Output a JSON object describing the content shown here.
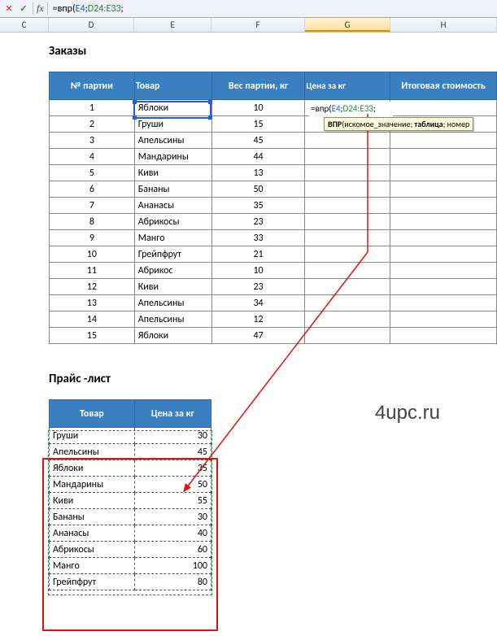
{
  "formula_bar": {
    "cancel": "✕",
    "enter": "✓",
    "fx": "fx",
    "formula_prefix": "=впр(",
    "arg1": "E4",
    "sep": ";",
    "arg2": "D24:E33",
    "suffix": ";"
  },
  "columns": {
    "C": "C",
    "D": "D",
    "E": "E",
    "F": "F",
    "G": "G",
    "H": "H"
  },
  "titles": {
    "orders": "Заказы",
    "price": "Прайс -лист"
  },
  "orders": {
    "headers": {
      "num": "№ партии",
      "product": "Товар",
      "weight": "Вес партии, кг",
      "price": "Цена за кг",
      "total": "Итоговая стоимость"
    },
    "rows": [
      {
        "n": "1",
        "p": "Яблоки",
        "w": "10"
      },
      {
        "n": "2",
        "p": "Груши",
        "w": "15"
      },
      {
        "n": "3",
        "p": "Апельсины",
        "w": "45"
      },
      {
        "n": "4",
        "p": "Мандарины",
        "w": "44"
      },
      {
        "n": "5",
        "p": "Киви",
        "w": "13"
      },
      {
        "n": "6",
        "p": "Бананы",
        "w": "50"
      },
      {
        "n": "7",
        "p": "Ананасы",
        "w": "35"
      },
      {
        "n": "8",
        "p": "Абрикосы",
        "w": "23"
      },
      {
        "n": "9",
        "p": "Манго",
        "w": "33"
      },
      {
        "n": "10",
        "p": "Грейпфрут",
        "w": "21"
      },
      {
        "n": "11",
        "p": "Абрикос",
        "w": "10"
      },
      {
        "n": "12",
        "p": "Киви",
        "w": "23"
      },
      {
        "n": "13",
        "p": "Апельсины",
        "w": "34"
      },
      {
        "n": "14",
        "p": "Апельсины",
        "w": "12"
      },
      {
        "n": "15",
        "p": "Яблоки",
        "w": "47"
      }
    ]
  },
  "active_cell_formula": {
    "prefix": "=впр(",
    "arg1": "E4",
    "sep": ";",
    "arg2": "D24:E33",
    "suffix": ";"
  },
  "tooltip": {
    "fn": "ВПР",
    "open": "(",
    "a1": "искомое_значение",
    "s1": "; ",
    "a2": "таблица",
    "s2": "; номер"
  },
  "price": {
    "headers": {
      "product": "Товар",
      "price": "Цена за кг"
    },
    "rows": [
      {
        "p": "Груши",
        "v": "30"
      },
      {
        "p": "Апельсины",
        "v": "45"
      },
      {
        "p": "Яблоки",
        "v": "35"
      },
      {
        "p": "Мандарины",
        "v": "50"
      },
      {
        "p": "Киви",
        "v": "55"
      },
      {
        "p": "Бананы",
        "v": "30"
      },
      {
        "p": "Ананасы",
        "v": "40"
      },
      {
        "p": "Абрикосы",
        "v": "60"
      },
      {
        "p": "Манго",
        "v": "100"
      },
      {
        "p": "Грейпфрут",
        "v": "80"
      }
    ]
  },
  "watermark": "4upc.ru",
  "chart_data": [
    {
      "type": "table",
      "title": "Заказы",
      "columns": [
        "№ партии",
        "Товар",
        "Вес партии, кг",
        "Цена за кг",
        "Итоговая стоимость"
      ],
      "rows": [
        [
          1,
          "Яблоки",
          10,
          null,
          null
        ],
        [
          2,
          "Груши",
          15,
          null,
          null
        ],
        [
          3,
          "Апельсины",
          45,
          null,
          null
        ],
        [
          4,
          "Мандарины",
          44,
          null,
          null
        ],
        [
          5,
          "Киви",
          13,
          null,
          null
        ],
        [
          6,
          "Бананы",
          50,
          null,
          null
        ],
        [
          7,
          "Ананасы",
          35,
          null,
          null
        ],
        [
          8,
          "Абрикосы",
          23,
          null,
          null
        ],
        [
          9,
          "Манго",
          33,
          null,
          null
        ],
        [
          10,
          "Грейпфрут",
          21,
          null,
          null
        ],
        [
          11,
          "Абрикос",
          10,
          null,
          null
        ],
        [
          12,
          "Киви",
          23,
          null,
          null
        ],
        [
          13,
          "Апельсины",
          34,
          null,
          null
        ],
        [
          14,
          "Апельсины",
          12,
          null,
          null
        ],
        [
          15,
          "Яблоки",
          47,
          null,
          null
        ]
      ]
    },
    {
      "type": "table",
      "title": "Прайс -лист",
      "columns": [
        "Товар",
        "Цена за кг"
      ],
      "rows": [
        [
          "Груши",
          30
        ],
        [
          "Апельсины",
          45
        ],
        [
          "Яблоки",
          35
        ],
        [
          "Мандарины",
          50
        ],
        [
          "Киви",
          55
        ],
        [
          "Бананы",
          30
        ],
        [
          "Ананасы",
          40
        ],
        [
          "Абрикосы",
          60
        ],
        [
          "Манго",
          100
        ],
        [
          "Грейпфрут",
          80
        ]
      ]
    }
  ]
}
